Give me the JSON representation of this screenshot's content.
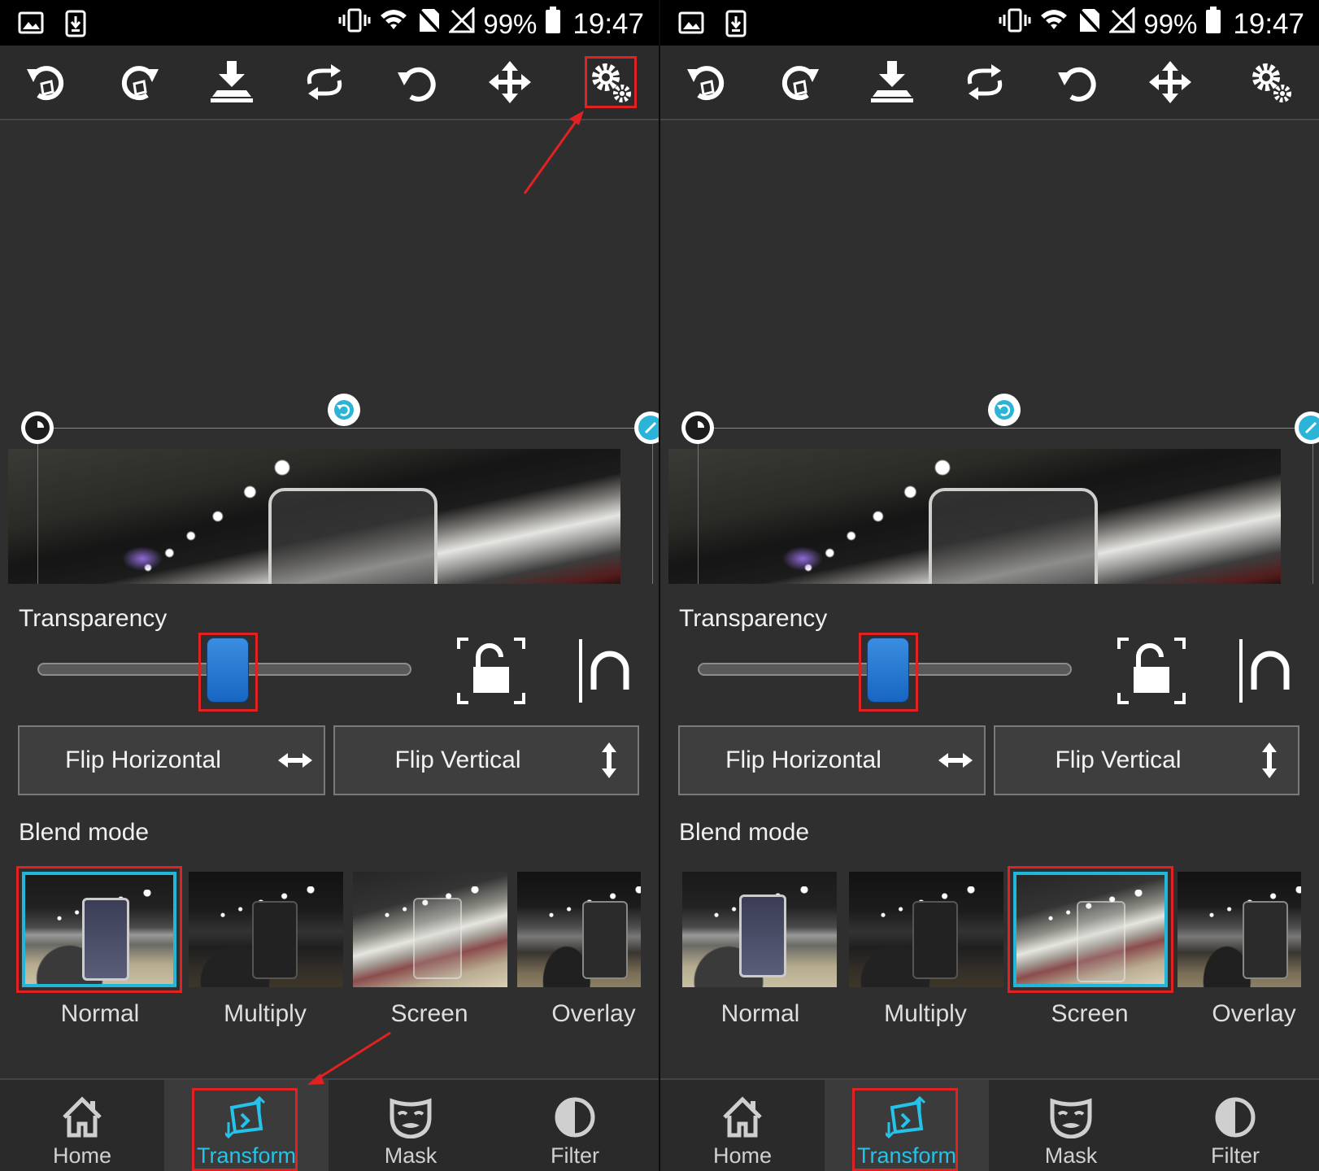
{
  "status_bar": {
    "battery_percent": "99%",
    "time": "19:47"
  },
  "toolbar": {
    "tools": [
      "undo-icon",
      "redo-icon",
      "download-icon",
      "swap-icon",
      "reset-rotation-icon",
      "move-icon",
      "settings-icon"
    ]
  },
  "controls": {
    "transparency_label": "Transparency",
    "transparency_value": 0.5,
    "flip_horizontal_label": "Flip Horizontal",
    "flip_vertical_label": "Flip Vertical",
    "blend_mode_label": "Blend mode"
  },
  "blend_modes": [
    "Normal",
    "Multiply",
    "Screen",
    "Overlay"
  ],
  "nav": {
    "home": "Home",
    "transform": "Transform",
    "mask": "Mask",
    "filter": "Filter"
  },
  "panels": [
    {
      "selected_blend_mode": "Normal",
      "highlighted_tool": "settings-icon"
    },
    {
      "selected_blend_mode": "Screen",
      "highlighted_tool": ""
    }
  ],
  "colors": {
    "accent": "#25c3ea",
    "highlight": "#e02222",
    "slider_thumb": "#1f75d1"
  }
}
